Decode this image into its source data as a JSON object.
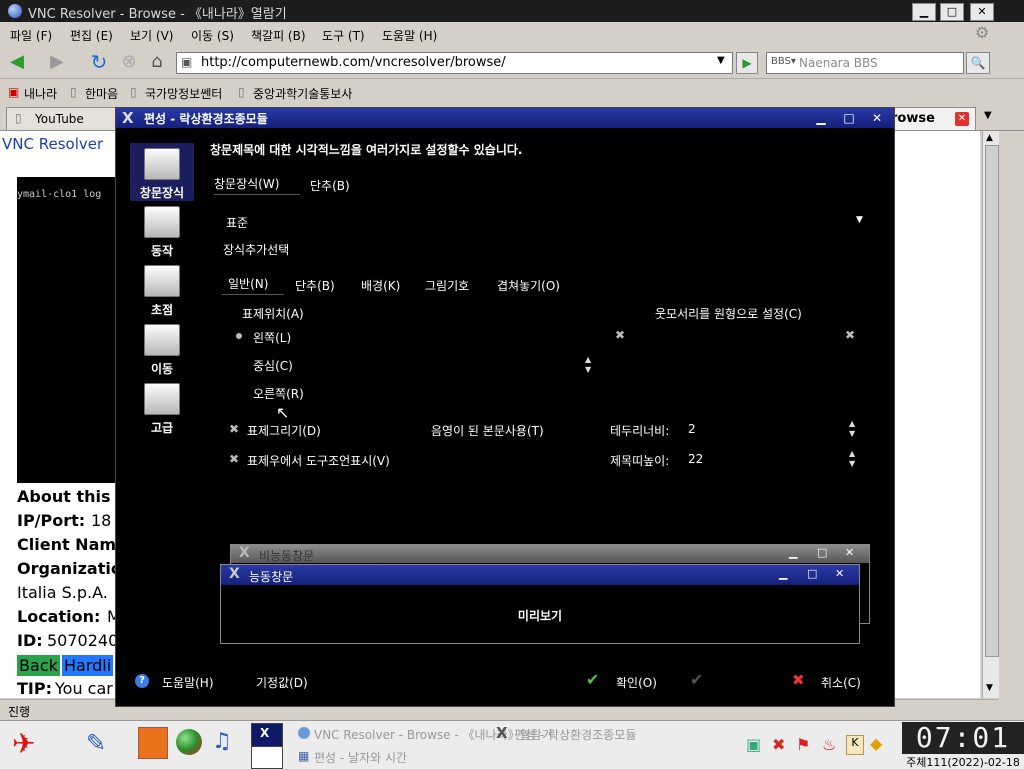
{
  "browser": {
    "title": "VNC Resolver - Browse - 《내나라》열람기",
    "menu": [
      "파일 (F)",
      "편집 (E)",
      "보기 (V)",
      "이동 (S)",
      "책갈피 (B)",
      "도구 (T)",
      "도움말 (H)"
    ],
    "url": "http://computernewb.com/vncresolver/browse/",
    "search_placeholder": "Naenara BBS",
    "bookmarks": [
      "내나라",
      "한마음",
      "국가망정보쎈터",
      "중앙과학기술통보사"
    ],
    "tabs": [
      "YouTube",
      "rowse"
    ],
    "status": "진행"
  },
  "page": {
    "heading": "VNC Resolver",
    "screen_text": "ymail-clo1 log",
    "about": "About this",
    "ipport_label": "IP/Port:",
    "ipport_value": "18",
    "client_label": "Client Nam",
    "org_label": "Organizatio",
    "org_value": "Italia S.p.A.",
    "location_label": "Location:",
    "location_value": "M",
    "id_label": "ID:",
    "id_value": "5070240",
    "back_button": "Back",
    "hardlink_button": "Hardli",
    "tip_label": "TIP:",
    "tip_value": "You car"
  },
  "dialog": {
    "title": "편성 - 락상환경조종모듈",
    "heading": "창문제목에 대한 시각적느낌을 여러가지로 설정할수 있습니다.",
    "sidebar": [
      "창문장식",
      "동작",
      "초점",
      "이동",
      "고급"
    ],
    "top_tabs": [
      "창문장식(W)",
      "단추(B)"
    ],
    "style_select": "표준",
    "decoration_option": "장식추가선택",
    "sub_tabs": [
      "일반(N)",
      "단추(B)",
      "배경(K)",
      "그림기호",
      "겹쳐놓기(O)"
    ],
    "title_position_label": "표제위치(A)",
    "title_positions": [
      "왼쪽(L)",
      "중심(C)",
      "오른쪽(R)"
    ],
    "rounded_corners": "웃모서리를 원형으로 설정(C)",
    "draw_title": "표제그리기(D)",
    "shaded_body": "음영이 된 본문사용(T)",
    "border_width_label": "테두리너비:",
    "border_width": "2",
    "show_tooltip": "표제우에서 도구조언표시(V)",
    "title_height_label": "제목띠높이:",
    "title_height": "22",
    "inactive_window": "비능동창문",
    "active_window": "능동창문",
    "preview_label": "미리보기",
    "help": "도움말(H)",
    "defaults": "기정값(D)",
    "ok": "확인(O)",
    "cancel": "취소(C)"
  },
  "taskbar": {
    "task1": "VNC Resolver - Browse - 《내나라》열람기",
    "task2": "편성 - 락상환경조종모듈",
    "task3": "편성 - 날자와 시간",
    "clock": "07:01",
    "date": "주체111(2022)-02-18"
  },
  "colors": {
    "dialog_title": "#1e2a94",
    "web_link": "#1a3fb0",
    "back_btn": "#2aa34a",
    "hardlink_btn": "#2478ff"
  }
}
